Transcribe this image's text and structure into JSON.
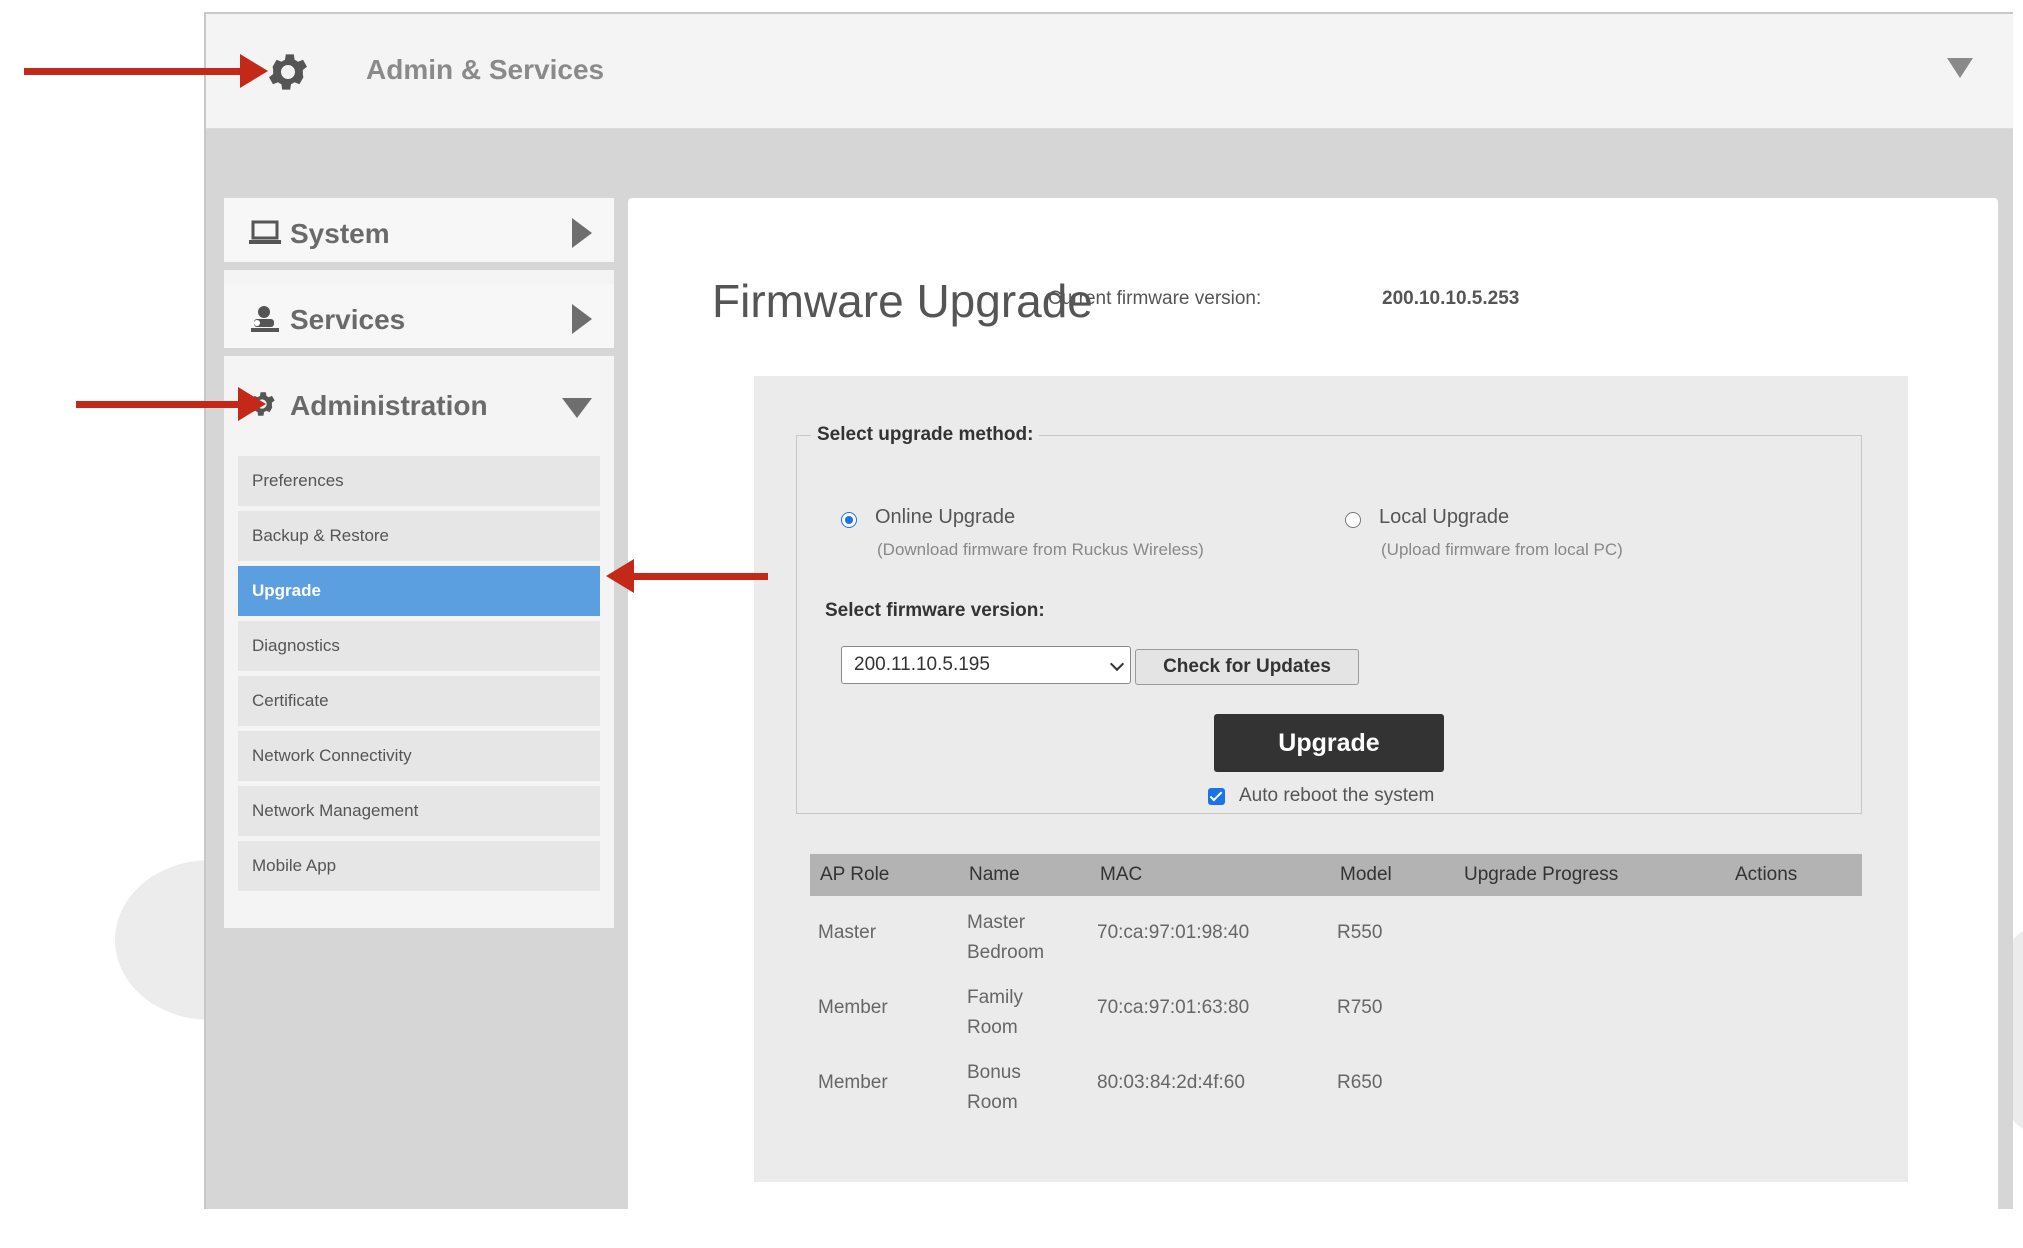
{
  "header": {
    "title": "Admin & Services"
  },
  "sidebar": {
    "sections": [
      {
        "label": "System",
        "icon": "laptop-icon",
        "expanded": false
      },
      {
        "label": "Services",
        "icon": "services-icon",
        "expanded": false
      },
      {
        "label": "Administration",
        "icon": "gear-icon",
        "expanded": true
      }
    ],
    "items": [
      {
        "label": "Preferences"
      },
      {
        "label": "Backup & Restore"
      },
      {
        "label": "Upgrade",
        "active": true
      },
      {
        "label": "Diagnostics"
      },
      {
        "label": "Certificate"
      },
      {
        "label": "Network Connectivity"
      },
      {
        "label": "Network Management"
      },
      {
        "label": "Mobile App"
      }
    ]
  },
  "main": {
    "title": "Firmware Upgrade",
    "current_fw_label": "Current firmware version:",
    "current_fw_value": "200.10.10.5.253",
    "method": {
      "legend": "Select upgrade method:",
      "options": [
        {
          "label": "Online Upgrade",
          "sub": "(Download firmware from Ruckus Wireless)",
          "selected": true
        },
        {
          "label": "Local Upgrade",
          "sub": "(Upload firmware from local PC)",
          "selected": false
        }
      ],
      "version_label": "Select firmware version:",
      "version_value": "200.11.10.5.195",
      "check_button": "Check for Updates",
      "upgrade_button": "Upgrade",
      "auto_reboot_label": "Auto reboot the system",
      "auto_reboot_checked": true
    },
    "table": {
      "headers": [
        "AP Role",
        "Name",
        "MAC",
        "Model",
        "Upgrade Progress",
        "Actions"
      ],
      "rows": [
        {
          "role": "Master",
          "name": "Master Bedroom",
          "mac": "70:ca:97:01:98:40",
          "model": "R550"
        },
        {
          "role": "Member",
          "name": "Family Room",
          "mac": "70:ca:97:01:63:80",
          "model": "R750"
        },
        {
          "role": "Member",
          "name": "Bonus Room",
          "mac": "80:03:84:2d:4f:60",
          "model": "R650"
        }
      ]
    }
  },
  "colors": {
    "accent": "#5b9fe0",
    "annotation": "#c42818"
  }
}
